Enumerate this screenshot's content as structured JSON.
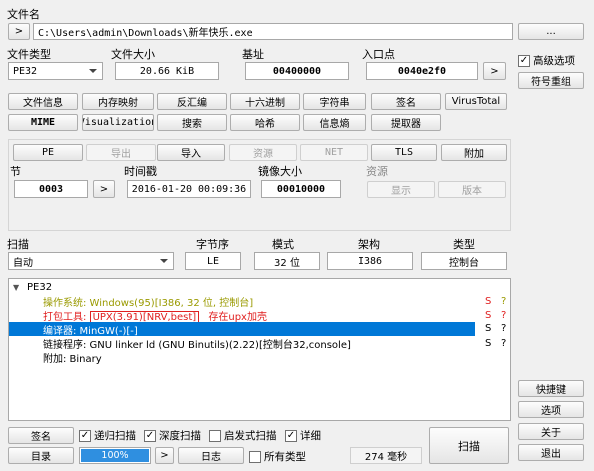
{
  "file": {
    "label": "文件名",
    "browse": ">",
    "path": "C:\\Users\\admin\\Downloads\\新年快乐.exe",
    "more": "..."
  },
  "info": {
    "file_type_label": "文件类型",
    "file_type_value": "PE32",
    "file_size_label": "文件大小",
    "file_size_value": "20.66 KiB",
    "base_label": "基址",
    "base_value": "00400000",
    "entry_label": "入口点",
    "entry_value": "0040e2f0",
    "entry_btn": ">"
  },
  "tools_row1": [
    "文件信息",
    "内存映射",
    "反汇编",
    "十六进制",
    "字符串",
    "签名",
    "VirusTotal"
  ],
  "tools_row2": [
    "MIME",
    "Visualization",
    "搜索",
    "哈希",
    "信息熵",
    "提取器"
  ],
  "sections_row": {
    "pe": "PE",
    "export": "导出",
    "import": "导入",
    "resource": "资源",
    "net": "NET",
    "tls": "TLS",
    "overlay": "附加"
  },
  "pe": {
    "section_label": "节",
    "section_value": "0003",
    "section_btn": ">",
    "timestamp_label": "时间戳",
    "timestamp_value": "2016-01-20 00:09:36",
    "image_size_label": "镜像大小",
    "image_size_value": "00010000",
    "resource_label": "资源",
    "show_btn": "显示",
    "version_btn": "版本"
  },
  "scan": {
    "scan_label": "扫描",
    "scan_value": "自动",
    "endian_label": "字节序",
    "endian_value": "LE",
    "mode_label": "模式",
    "mode_value": "32 位",
    "arch_label": "架构",
    "arch_value": "I386",
    "type_label": "类型",
    "type_value": "控制台"
  },
  "results": {
    "root": "PE32",
    "rows": [
      {
        "label": "操作系统: Windows(95)[I386, 32 位, 控制台]",
        "s": "S",
        "q": "?"
      },
      {
        "label": "打包工具: ",
        "boxed": "UPX(3.91)[NRV,best]",
        "note": "存在upx加壳",
        "s": "S",
        "q": "?"
      },
      {
        "label": "编译器: MinGW(-)[-]",
        "s": "S",
        "q": "?"
      },
      {
        "label": "链接程序: GNU linker ld (GNU Binutils)(2.22)[控制台32,console]",
        "s": "S",
        "q": "?"
      },
      {
        "label": "附加: Binary",
        "s": "",
        "q": ""
      }
    ]
  },
  "right": {
    "advanced_label": "高级选项",
    "advanced_checked": "✓",
    "symbol_btn": "符号重组",
    "shortcut_btn": "快捷键",
    "options_btn": "选项",
    "about_btn": "关于",
    "exit_btn": "退出"
  },
  "bottom": {
    "sign_btn": "签名",
    "recursive_label": "递归扫描",
    "deep_label": "深度扫描",
    "heuristic_label": "启发式扫描",
    "verbose_label": "详细",
    "check": "✓",
    "dir_btn": "目录",
    "progress_text": "100%",
    "progress_value": 1.0,
    "next_btn": ">",
    "log_btn": "日志",
    "all_types_label": "所有类型",
    "time_text": "274 毫秒",
    "scan_btn": "扫描"
  },
  "colors": {
    "accent": "#0078d7",
    "progress": "#2f8fe0",
    "red": "#e02020",
    "olive": "#9a9a00"
  }
}
